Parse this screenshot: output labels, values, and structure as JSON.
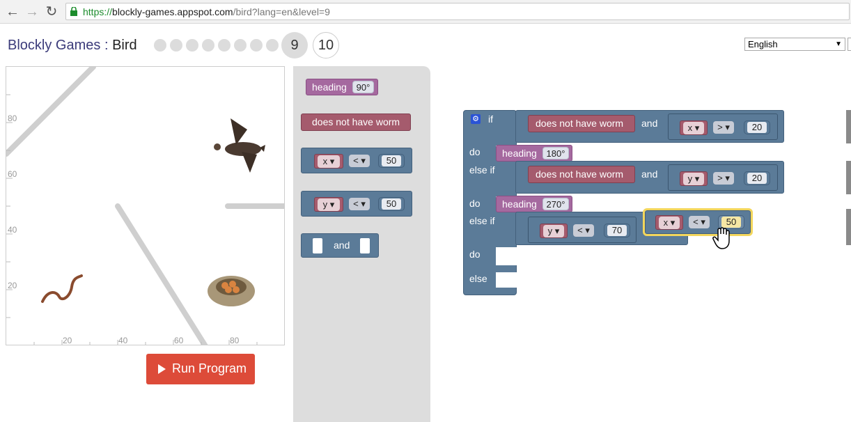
{
  "browser": {
    "url_protocol": "https://",
    "url_host": "blockly-games.appspot.com",
    "url_path": "/bird?lang=en&level=9",
    "back_icon": "back-arrow-icon",
    "forward_icon": "forward-arrow-icon",
    "reload_icon": "reload-icon"
  },
  "header": {
    "brand": "Blockly Games",
    "separator": ":",
    "game": "Bird",
    "levels": [
      "1",
      "2",
      "3",
      "4",
      "5",
      "6",
      "7",
      "8",
      "9",
      "10"
    ],
    "current_level": "9",
    "next_level": "10",
    "language": "English"
  },
  "game_area": {
    "axis_labels_x": [
      "20",
      "40",
      "60",
      "80"
    ],
    "axis_labels_y": [
      "80",
      "60",
      "40",
      "20"
    ]
  },
  "run_button": {
    "label": "Run Program"
  },
  "toolbox": {
    "heading_label": "heading",
    "heading_value": "90°",
    "no_worm_label": "does not have worm",
    "cmp_x_var": "x",
    "cmp_x_op": "<",
    "cmp_x_val": "50",
    "cmp_y_var": "y",
    "cmp_y_op": "<",
    "cmp_y_val": "50",
    "and_label": "and"
  },
  "workspace": {
    "if_label": "if",
    "do_label": "do",
    "else_if_label": "else if",
    "else_label": "else",
    "and_label": "and",
    "no_worm_label": "does not have worm",
    "row1_var": "x",
    "row1_op": ">",
    "row1_val": "20",
    "row1_heading": "heading",
    "row1_heading_val": "180°",
    "row2_var": "y",
    "row2_op": ">",
    "row2_val": "20",
    "row2_heading": "heading",
    "row2_heading_val": "270°",
    "row3_var": "y",
    "row3_op": "<",
    "row3_val": "70",
    "drag_var": "x",
    "drag_op": "<",
    "drag_val": "50"
  }
}
